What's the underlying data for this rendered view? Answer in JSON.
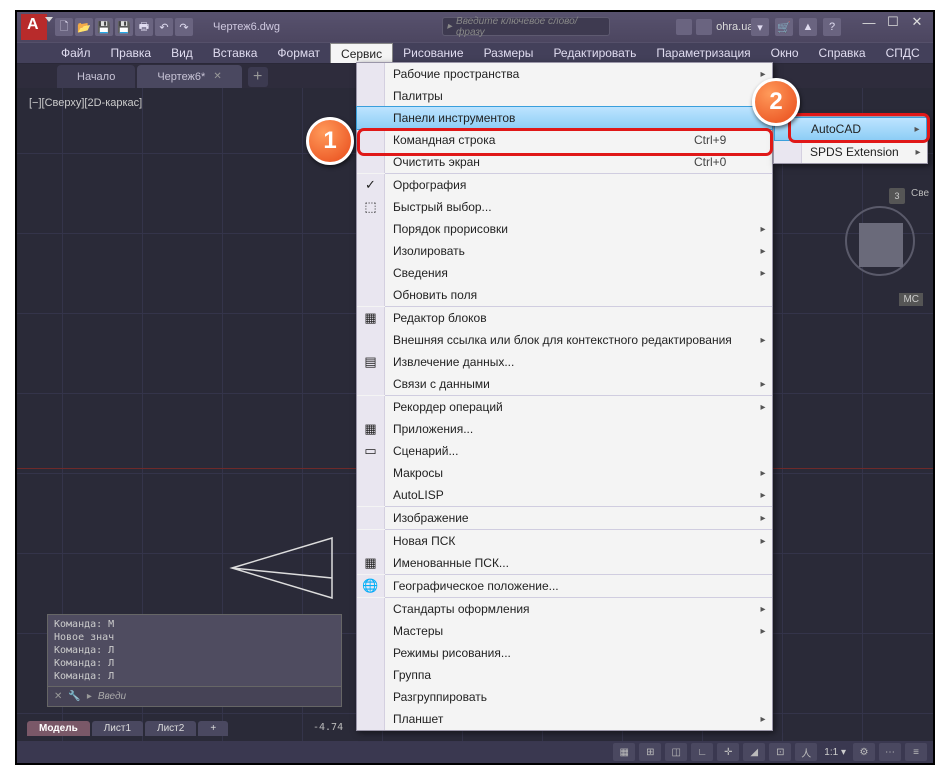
{
  "title_bar": {
    "doc_name": "Чертеж6.dwg",
    "search_placeholder": "Введите ключевое слово/фразу",
    "user_name": "ohra.ua"
  },
  "menubar": {
    "items": [
      "Файл",
      "Правка",
      "Вид",
      "Вставка",
      "Формат",
      "Сервис",
      "Рисование",
      "Размеры",
      "Редактировать",
      "Параметризация",
      "Окно",
      "Справка",
      "СПДС"
    ],
    "active_index": 5
  },
  "tabs": {
    "items": [
      {
        "label": "Начало",
        "active": false,
        "closeable": false
      },
      {
        "label": "Чертеж6*",
        "active": true,
        "closeable": true
      }
    ]
  },
  "canvas": {
    "view_label": "[−][Сверху][2D-каркас]",
    "coord": "-4.74",
    "viewcube": {
      "dir": "3",
      "label": "Све",
      "wcs": "МС"
    }
  },
  "cmd": {
    "history": "Команда: М\nНовое знач\nКоманда: Л\nКоманда: Л\nКоманда: Л",
    "prompt": "Введи",
    "icon1": "✕",
    "icon2": "🔧",
    "icon3": "▸"
  },
  "model_tabs": {
    "items": [
      "Модель",
      "Лист1",
      "Лист2"
    ],
    "active": 0
  },
  "dropdown": {
    "groups": [
      [
        {
          "label": "Рабочие пространства",
          "sub": true
        },
        {
          "label": "Палитры",
          "sub": true
        },
        {
          "label": "Панели инструментов",
          "sub": true,
          "hl": true
        },
        {
          "label": "Командная строка",
          "short": "Ctrl+9"
        },
        {
          "label": "Очистить экран",
          "short": "Ctrl+0"
        }
      ],
      [
        {
          "icon": "✓",
          "label": "Орфография"
        },
        {
          "icon": "⬚",
          "label": "Быстрый выбор..."
        },
        {
          "label": "Порядок прорисовки",
          "sub": true
        },
        {
          "label": "Изолировать",
          "sub": true
        },
        {
          "label": "Сведения",
          "sub": true
        },
        {
          "label": "Обновить поля"
        }
      ],
      [
        {
          "icon": "▦",
          "label": "Редактор блоков"
        },
        {
          "label": "Внешняя ссылка или блок для контекстного редактирования",
          "sub": true
        },
        {
          "icon": "▤",
          "label": "Извлечение данных..."
        },
        {
          "label": "Связи с данными",
          "sub": true
        }
      ],
      [
        {
          "label": "Рекордер операций",
          "sub": true
        },
        {
          "icon": "▦",
          "label": "Приложения..."
        },
        {
          "icon": "▭",
          "label": "Сценарий..."
        },
        {
          "label": "Макросы",
          "sub": true
        },
        {
          "label": "AutoLISP",
          "sub": true
        }
      ],
      [
        {
          "label": "Изображение",
          "sub": true
        }
      ],
      [
        {
          "label": "Новая ПСК",
          "sub": true
        },
        {
          "icon": "▦",
          "label": "Именованные ПСК..."
        }
      ],
      [
        {
          "icon": "🌐",
          "label": "Географическое положение..."
        }
      ],
      [
        {
          "label": "Стандарты оформления",
          "sub": true
        },
        {
          "label": "Мастеры",
          "sub": true
        },
        {
          "label": "Режимы рисования..."
        },
        {
          "label": "Группа"
        },
        {
          "label": "Разгруппировать"
        },
        {
          "label": "Планшет",
          "sub": true
        }
      ]
    ]
  },
  "submenu": {
    "items": [
      {
        "label": "AutoCAD",
        "hl": true,
        "sub": true
      },
      {
        "label": "SPDS Extension",
        "sub": true
      }
    ]
  },
  "status": {
    "scale": "1:1"
  },
  "annotations": {
    "n1": "1",
    "n2": "2"
  }
}
